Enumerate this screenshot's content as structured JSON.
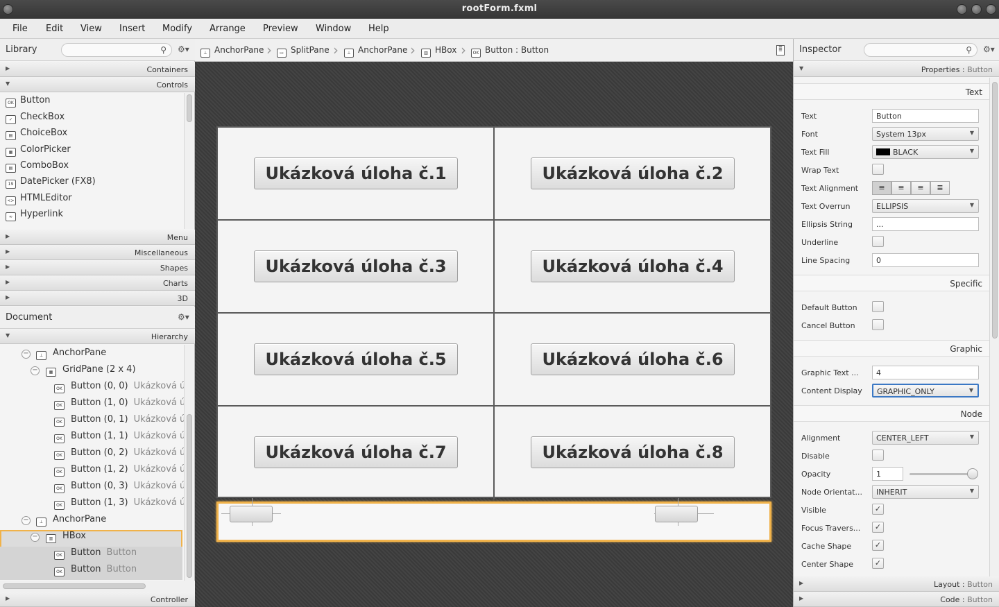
{
  "window": {
    "title": "rootForm.fxml"
  },
  "menu": [
    "File",
    "Edit",
    "View",
    "Insert",
    "Modify",
    "Arrange",
    "Preview",
    "Window",
    "Help"
  ],
  "library": {
    "title": "Library",
    "sections_top": [
      {
        "name": "Containers",
        "expanded": false
      },
      {
        "name": "Controls",
        "expanded": true
      }
    ],
    "items": [
      {
        "icon": "OK",
        "label": "Button"
      },
      {
        "icon": "✓",
        "label": "CheckBox"
      },
      {
        "icon": "▤",
        "label": "ChoiceBox"
      },
      {
        "icon": "▦",
        "label": "ColorPicker"
      },
      {
        "icon": "▤",
        "label": "ComboBox"
      },
      {
        "icon": "19",
        "label": "DatePicker  (FX8)"
      },
      {
        "icon": "<>",
        "label": "HTMLEditor"
      },
      {
        "icon": "∞",
        "label": "Hyperlink"
      }
    ],
    "sections_bottom": [
      "Menu",
      "Miscellaneous",
      "Shapes",
      "Charts",
      "3D"
    ]
  },
  "document": {
    "title": "Document",
    "hierarchy_label": "Hierarchy",
    "tree": [
      {
        "label": "AnchorPane",
        "muted": "",
        "icon": "⊥"
      },
      {
        "label": "GridPane (2 x 4)",
        "muted": "",
        "icon": "▦"
      },
      {
        "label": "Button (0, 0)",
        "muted": "Ukázková ú",
        "icon": "OK"
      },
      {
        "label": "Button (1, 0)",
        "muted": "Ukázková ú",
        "icon": "OK"
      },
      {
        "label": "Button (0, 1)",
        "muted": "Ukázková ú",
        "icon": "OK"
      },
      {
        "label": "Button (1, 1)",
        "muted": "Ukázková ú",
        "icon": "OK"
      },
      {
        "label": "Button (0, 2)",
        "muted": "Ukázková ú",
        "icon": "OK"
      },
      {
        "label": "Button (1, 2)",
        "muted": "Ukázková ú",
        "icon": "OK"
      },
      {
        "label": "Button (0, 3)",
        "muted": "Ukázková ú",
        "icon": "OK"
      },
      {
        "label": "Button (1, 3)",
        "muted": "Ukázková ú",
        "icon": "OK"
      },
      {
        "label": "AnchorPane",
        "muted": "",
        "icon": "⊥"
      },
      {
        "label": "HBox",
        "muted": "",
        "icon": "▥"
      },
      {
        "label": "Button",
        "muted": "Button",
        "icon": "OK"
      },
      {
        "label": "Button",
        "muted": "Button",
        "icon": "OK"
      }
    ],
    "controller_label": "Controller"
  },
  "breadcrumb": [
    {
      "icon": "⊥",
      "label": "AnchorPane"
    },
    {
      "icon": "▭",
      "label": "SplitPane"
    },
    {
      "icon": "⊥",
      "label": "AnchorPane"
    },
    {
      "icon": "▥",
      "label": "HBox"
    },
    {
      "icon": "OK",
      "label": "Button : Button"
    }
  ],
  "canvas": {
    "buttons": [
      "Ukázková úloha č.1",
      "Ukázková úloha č.2",
      "Ukázková úloha č.3",
      "Ukázková úloha č.4",
      "Ukázková úloha č.5",
      "Ukázková úloha č.6",
      "Ukázková úloha č.7",
      "Ukázková úloha č.8"
    ]
  },
  "inspector": {
    "title": "Inspector",
    "properties_label": "Properties",
    "properties_target": "Button",
    "groups": {
      "text": "Text",
      "specific": "Specific",
      "graphic": "Graphic",
      "node": "Node"
    },
    "text_props": {
      "text_label": "Text",
      "text_value": "Button",
      "font_label": "Font",
      "font_value": "System 13px",
      "fill_label": "Text Fill",
      "fill_value": "BLACK",
      "wrap_label": "Wrap Text",
      "align_label": "Text Alignment",
      "overrun_label": "Text Overrun",
      "overrun_value": "ELLIPSIS",
      "ellipsis_label": "Ellipsis String",
      "ellipsis_value": "...",
      "underline_label": "Underline",
      "spacing_label": "Line Spacing",
      "spacing_value": "0"
    },
    "specific_props": {
      "default_label": "Default Button",
      "cancel_label": "Cancel Button"
    },
    "graphic_props": {
      "gap_label": "Graphic Text ...",
      "gap_value": "4",
      "display_label": "Content Display",
      "display_value": "GRAPHIC_ONLY"
    },
    "node_props": {
      "alignment_label": "Alignment",
      "alignment_value": "CENTER_LEFT",
      "disable_label": "Disable",
      "opacity_label": "Opacity",
      "opacity_value": "1",
      "orientation_label": "Node Orientat...",
      "orientation_value": "INHERIT",
      "visible_label": "Visible",
      "focus_label": "Focus Travers...",
      "cache_label": "Cache Shape",
      "center_label": "Center Shape"
    },
    "layout_label": "Layout",
    "code_label": "Code",
    "target": "Button"
  },
  "colors": {
    "selection": "#f0b24a",
    "canvas_bg": "#3e3e3e"
  }
}
